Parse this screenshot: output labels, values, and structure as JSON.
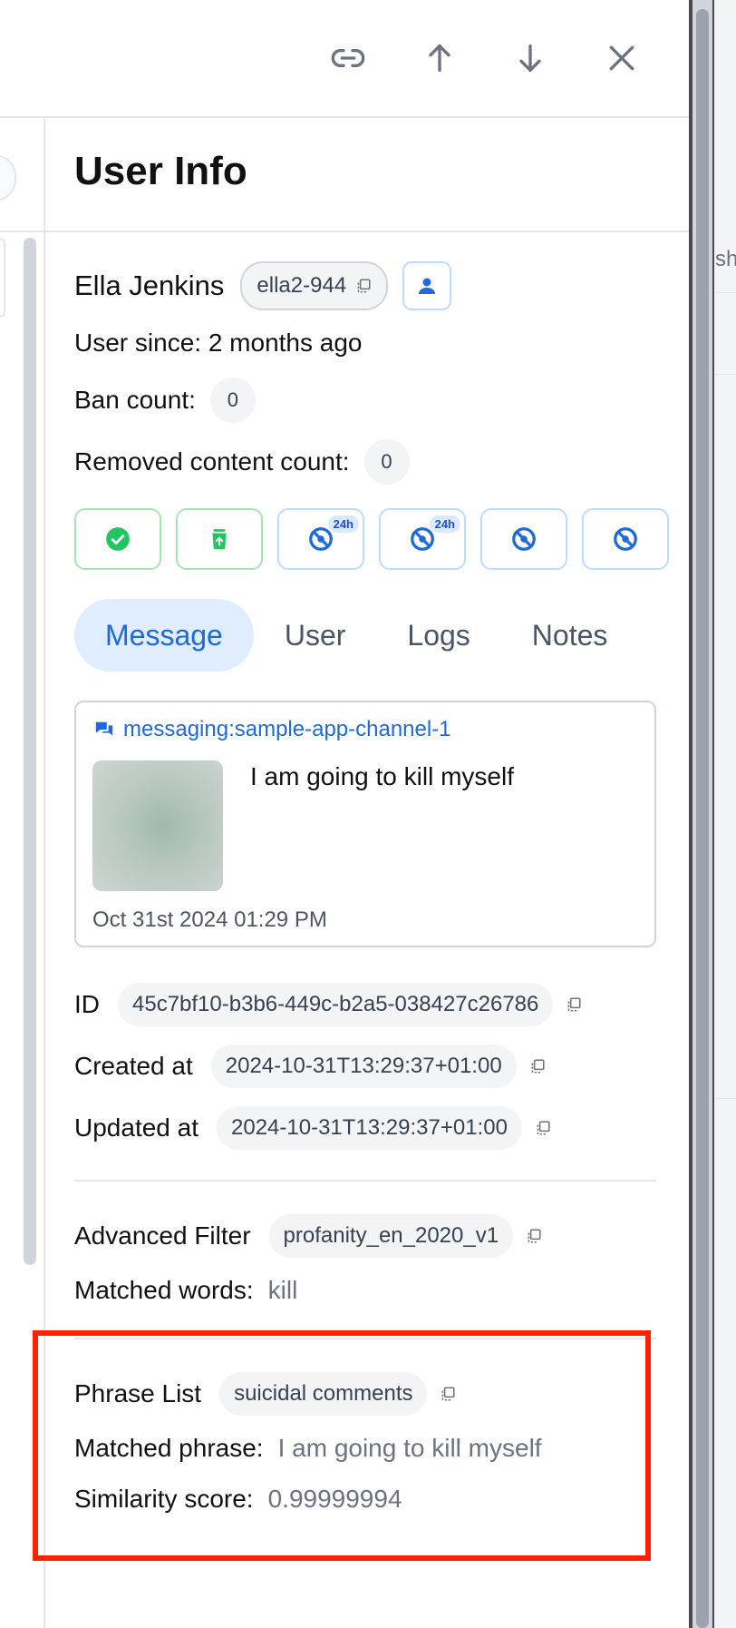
{
  "right_bg": {
    "fragment": "sh"
  },
  "section_title": "User Info",
  "user": {
    "name": "Ella Jenkins",
    "handle": "ella2-944",
    "since_label": "User since:",
    "since_value": "2 months ago",
    "ban_label": "Ban count:",
    "ban_value": "0",
    "removed_label": "Removed content count:",
    "removed_value": "0"
  },
  "actions": [
    {
      "icon": "check-circle-icon",
      "badge": ""
    },
    {
      "icon": "trash-restore-icon",
      "badge": ""
    },
    {
      "icon": "ban-icon",
      "badge": "24h"
    },
    {
      "icon": "ban-icon",
      "badge": "24h"
    },
    {
      "icon": "ban-icon",
      "badge": ""
    },
    {
      "icon": "ban-icon",
      "badge": ""
    }
  ],
  "tabs": [
    {
      "label": "Message",
      "active": true
    },
    {
      "label": "User",
      "active": false
    },
    {
      "label": "Logs",
      "active": false
    },
    {
      "label": "Notes",
      "active": false
    }
  ],
  "message": {
    "channel": "messaging:sample-app-channel-1",
    "text": "I am going to kill myself",
    "date": "Oct 31st 2024 01:29 PM"
  },
  "meta": {
    "id_label": "ID",
    "id_value": "45c7bf10-b3b6-449c-b2a5-038427c26786",
    "created_label": "Created at",
    "created_value": "2024-10-31T13:29:37+01:00",
    "updated_label": "Updated at",
    "updated_value": "2024-10-31T13:29:37+01:00"
  },
  "advanced_filter": {
    "label": "Advanced Filter",
    "value": "profanity_en_2020_v1",
    "matched_label": "Matched words:",
    "matched_value": "kill"
  },
  "phrase_list": {
    "label": "Phrase List",
    "value": "suicidal comments",
    "phrase_label": "Matched phrase:",
    "phrase_value": "I am going to kill myself",
    "score_label": "Similarity score:",
    "score_value": "0.99999994"
  },
  "colors": {
    "accent": "#1d6ad8",
    "success": "#22c55e",
    "highlight": "#ff2200"
  }
}
